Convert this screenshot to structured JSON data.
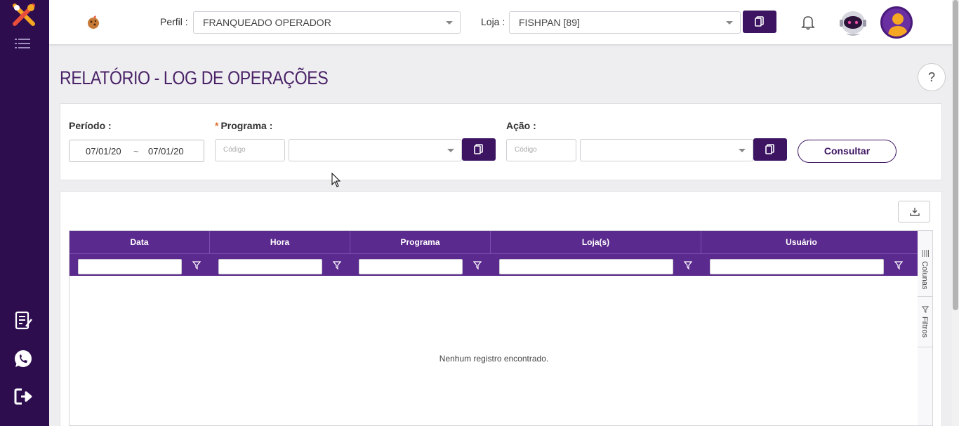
{
  "header": {
    "perfil_label": "Perfil :",
    "perfil_value": "FRANQUEADO OPERADOR",
    "loja_label": "Loja :",
    "loja_value": "FISHPAN [89]"
  },
  "page": {
    "title": "RELATÓRIO - LOG DE OPERAÇÕES",
    "help": "?"
  },
  "filters": {
    "periodo_label": "Período :",
    "date_from": "07/01/20",
    "date_sep": "~",
    "date_to": "07/01/20",
    "programa_required": "*",
    "programa_label": "Programa :",
    "programa_code_placeholder": "Código",
    "acao_label": "Ação :",
    "acao_code_placeholder": "Código",
    "consult_label": "Consultar"
  },
  "grid": {
    "columns": [
      "Data",
      "Hora",
      "Programa",
      "Loja(s)",
      "Usuário"
    ],
    "empty_message": "Nenhum registro encontrado.",
    "side_tabs": [
      "Colunas",
      "Filtros"
    ]
  },
  "colors": {
    "sidebar": "#2e0d4f",
    "accent": "#3c1461",
    "grid_header": "#5b2a8e",
    "title": "#4a2267"
  },
  "icons": {
    "sidebar": [
      "app-logo-icon",
      "menu-icon",
      "report-icon",
      "whatsapp-icon",
      "logout-icon"
    ],
    "header": [
      "cookie-logo-icon",
      "copy-icon",
      "bell-icon",
      "robot-avatar-icon",
      "user-avatar-icon"
    ]
  }
}
